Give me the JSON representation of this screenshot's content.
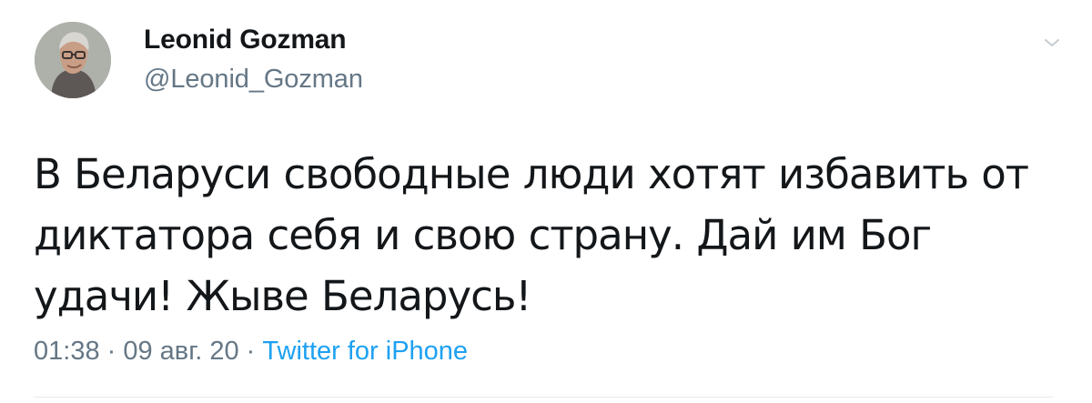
{
  "tweet": {
    "author": {
      "display_name": "Leonid Gozman",
      "handle": "@Leonid_Gozman"
    },
    "text": "В Беларуси свободные люди хотят избавить от диктатора себя и свою страну. Дай им Бог удачи! Жыве Беларусь!",
    "time": "01:38",
    "date": "09 авг. 20",
    "source": "Twitter for iPhone",
    "separator": " · "
  },
  "icons": {
    "avatar": "profile-photo",
    "menu": "chevron-down-icon"
  },
  "colors": {
    "primary_text": "#14171a",
    "secondary_text": "#657786",
    "link": "#1da1f2",
    "divider": "#e6ecf0"
  }
}
